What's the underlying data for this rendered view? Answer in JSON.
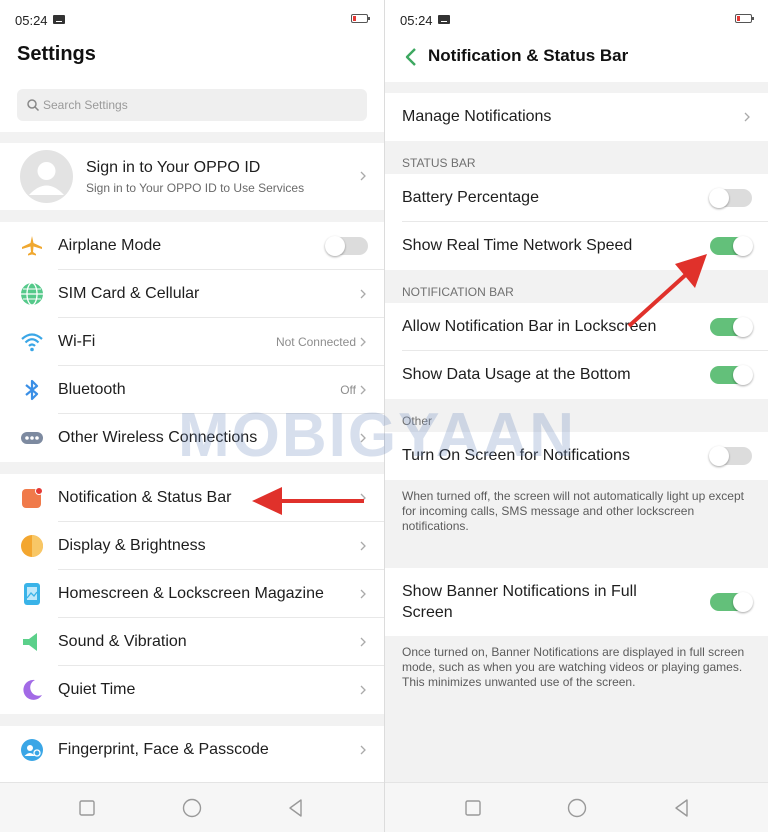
{
  "status": {
    "time": "05:24"
  },
  "left": {
    "title": "Settings",
    "search_placeholder": "Search Settings",
    "account": {
      "title": "Sign in to Your OPPO ID",
      "subtitle": "Sign in to Your OPPO ID to Use Services"
    },
    "group1": [
      {
        "label": "Airplane Mode",
        "icon": "airplane-icon",
        "toggle": "off"
      },
      {
        "label": "SIM Card & Cellular",
        "icon": "globe-icon"
      },
      {
        "label": "Wi-Fi",
        "icon": "wifi-icon",
        "value": "Not Connected"
      },
      {
        "label": "Bluetooth",
        "icon": "bluetooth-icon",
        "value": "Off"
      },
      {
        "label": "Other Wireless Connections",
        "icon": "more-dots-icon"
      }
    ],
    "group2": [
      {
        "label": "Notification & Status Bar",
        "icon": "notification-icon"
      },
      {
        "label": "Display & Brightness",
        "icon": "brightness-icon"
      },
      {
        "label": "Homescreen & Lockscreen Magazine",
        "icon": "picture-icon"
      },
      {
        "label": "Sound & Vibration",
        "icon": "speaker-icon"
      },
      {
        "label": "Quiet Time",
        "icon": "moon-icon"
      }
    ],
    "group3": [
      {
        "label": "Fingerprint, Face & Passcode",
        "icon": "face-lock-icon"
      }
    ]
  },
  "right": {
    "title": "Notification & Status Bar",
    "manage_notifications": "Manage Notifications",
    "status_bar_header": "STATUS BAR",
    "battery_percentage": {
      "label": "Battery Percentage",
      "toggle": "off"
    },
    "network_speed": {
      "label": "Show Real Time Network Speed",
      "toggle": "on"
    },
    "notification_bar_header": "NOTIFICATION BAR",
    "lockscreen_bar": {
      "label": "Allow Notification Bar in Lockscreen",
      "toggle": "on"
    },
    "data_usage": {
      "label": "Show Data Usage at the Bottom",
      "toggle": "on"
    },
    "other_header": "Other",
    "screen_on": {
      "label": "Turn On Screen for Notifications",
      "toggle": "off"
    },
    "screen_on_desc": "When turned off, the screen will not automatically light up except for incoming calls, SMS message and other lockscreen notifications.",
    "banner_line1": "Show Banner Notifications in Full",
    "banner_line2": "Screen",
    "banner_toggle": "on",
    "banner_desc": "Once turned on, Banner Notifications are displayed in full screen mode, such as when you are watching videos or playing games. This minimizes unwanted use of the screen."
  },
  "colors": {
    "toggle_on": "#63c07a",
    "back_arrow": "#3da860",
    "annotation_arrow": "#e0312b"
  },
  "watermark": "MOBIGYAAN"
}
